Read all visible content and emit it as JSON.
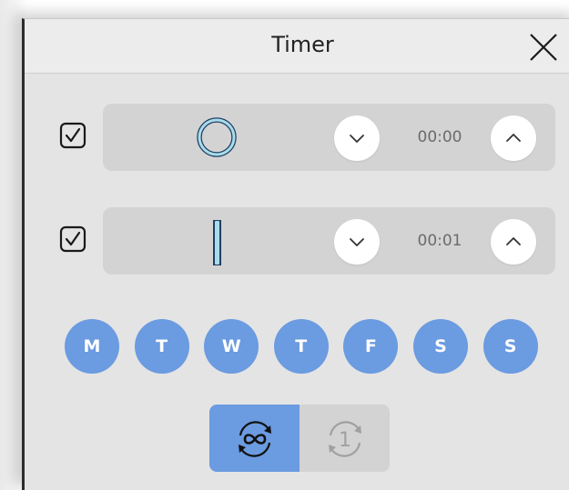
{
  "window": {
    "title": "Timer"
  },
  "rows": [
    {
      "checked": true,
      "indicator": "circle-ring-icon",
      "time": "00:00"
    },
    {
      "checked": true,
      "indicator": "bar-icon",
      "time": "00:01"
    }
  ],
  "days": [
    {
      "label": "M",
      "active": true
    },
    {
      "label": "T",
      "active": true
    },
    {
      "label": "W",
      "active": true
    },
    {
      "label": "T",
      "active": true
    },
    {
      "label": "F",
      "active": true
    },
    {
      "label": "S",
      "active": true
    },
    {
      "label": "S",
      "active": true
    }
  ],
  "mode": {
    "selected": "repeat",
    "options": [
      {
        "id": "repeat",
        "icon": "repeat-infinite-icon"
      },
      {
        "id": "once",
        "icon": "repeat-once-icon",
        "label": "1"
      }
    ]
  },
  "colors": {
    "accent": "#6b9be0",
    "panel": "#d3d3d3",
    "background": "#e4e4e4",
    "indicator_fill": "#a9dcea"
  }
}
